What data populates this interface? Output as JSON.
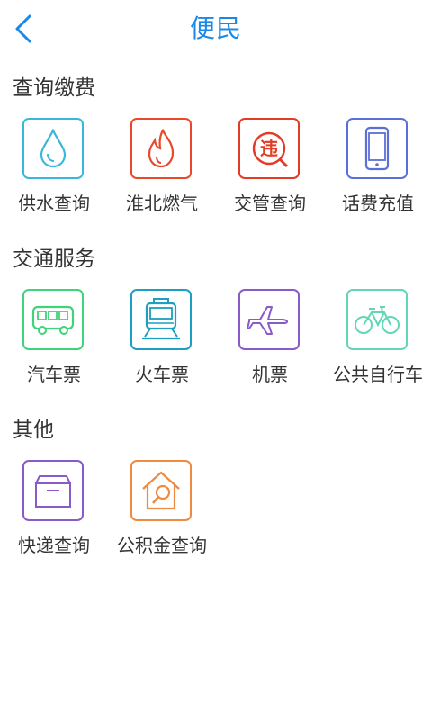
{
  "header": {
    "title": "便民",
    "back_icon": "chevron-left-icon"
  },
  "sections": [
    {
      "title": "查询缴费",
      "items": [
        {
          "label": "供水查询",
          "icon": "water-drop-icon",
          "color": "#3ab7db"
        },
        {
          "label": "淮北燃气",
          "icon": "flame-icon",
          "color": "#e8492a"
        },
        {
          "label": "交管查询",
          "icon": "traffic-violation-icon",
          "color": "#e23b26"
        },
        {
          "label": "话费充值",
          "icon": "phone-icon",
          "color": "#5b6fd6"
        }
      ]
    },
    {
      "title": "交通服务",
      "items": [
        {
          "label": "汽车票",
          "icon": "bus-icon",
          "color": "#3fd37a"
        },
        {
          "label": "火车票",
          "icon": "train-icon",
          "color": "#1c9fc0"
        },
        {
          "label": "机票",
          "icon": "airplane-icon",
          "color": "#8a5ac9"
        },
        {
          "label": "公共自行车",
          "icon": "bicycle-icon",
          "color": "#62d7b7"
        }
      ]
    },
    {
      "title": "其他",
      "items": [
        {
          "label": "快递查询",
          "icon": "package-icon",
          "color": "#8a5ac9"
        },
        {
          "label": "公积金查询",
          "icon": "house-search-icon",
          "color": "#ee8a42"
        }
      ]
    }
  ]
}
